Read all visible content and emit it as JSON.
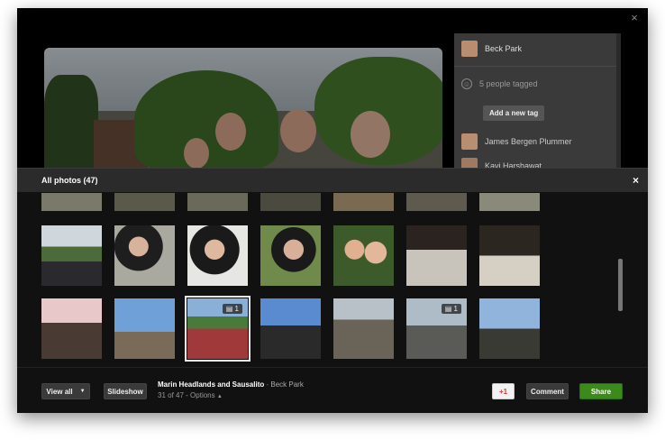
{
  "window": {
    "close_symbol": "×"
  },
  "tag_panel": {
    "owner": "Beck Park",
    "tagged_count": "5 people tagged",
    "add_tag": "Add a new tag",
    "people": [
      "James Bergen Plummer",
      "Kavi Harshawat"
    ]
  },
  "album_bar": {
    "title": "All photos (47)",
    "close_symbol": "×"
  },
  "grid": {
    "badge_1": "1",
    "badge_2": "1"
  },
  "footer": {
    "view_all": "View all",
    "slideshow": "Slideshow",
    "photo_title": "Marin Headlands and Sausalito",
    "photo_owner": "Beck Park",
    "position": "31 of 47",
    "options": "Options",
    "plus_one": "+1",
    "comment": "Comment",
    "share": "Share"
  },
  "colors": {
    "share_green": "#3c8a1c",
    "plus_one_red": "#d63b2f"
  }
}
